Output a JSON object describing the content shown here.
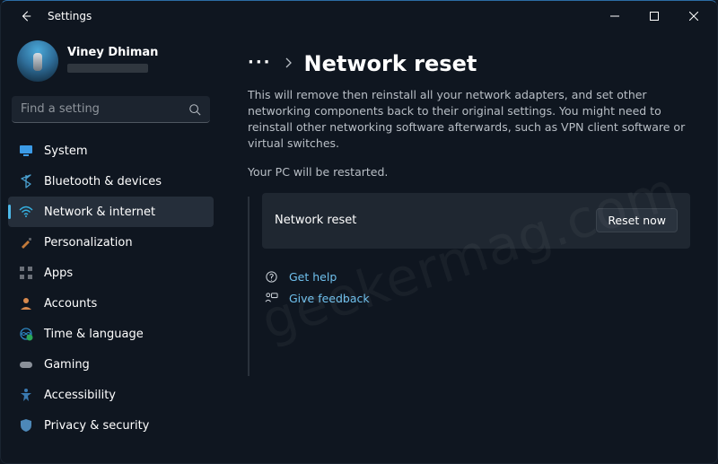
{
  "window": {
    "app_title": "Settings"
  },
  "profile": {
    "name": "Viney Dhiman"
  },
  "search": {
    "placeholder": "Find a setting"
  },
  "sidebar": {
    "items": [
      {
        "id": "system",
        "label": "System",
        "icon": "monitor",
        "color": "#3c9be6"
      },
      {
        "id": "bluetooth",
        "label": "Bluetooth & devices",
        "icon": "bluetooth",
        "color": "#4aa0d0"
      },
      {
        "id": "network",
        "label": "Network & internet",
        "icon": "wifi",
        "color": "#35b0e0",
        "selected": true
      },
      {
        "id": "personalization",
        "label": "Personalization",
        "icon": "brush",
        "color": "#c37a3a"
      },
      {
        "id": "apps",
        "label": "Apps",
        "icon": "apps",
        "color": "#6b7078"
      },
      {
        "id": "accounts",
        "label": "Accounts",
        "icon": "person",
        "color": "#d98a4e"
      },
      {
        "id": "time",
        "label": "Time & language",
        "icon": "globe-clock",
        "color": "#2e86c1"
      },
      {
        "id": "gaming",
        "label": "Gaming",
        "icon": "gamepad",
        "color": "#8a9099"
      },
      {
        "id": "accessibility",
        "label": "Accessibility",
        "icon": "accessibility",
        "color": "#3a7ab1"
      },
      {
        "id": "privacy",
        "label": "Privacy & security",
        "icon": "shield",
        "color": "#4d88b8"
      }
    ]
  },
  "breadcrumb": {
    "more": "···",
    "title": "Network reset"
  },
  "page": {
    "description": "This will remove then reinstall all your network adapters, and set other networking components back to their original settings. You might need to reinstall other networking software afterwards, such as VPN client software or virtual switches.",
    "restart_note": "Your PC will be restarted.",
    "card": {
      "label": "Network reset",
      "button": "Reset now"
    },
    "links": {
      "help": "Get help",
      "feedback": "Give feedback"
    }
  },
  "watermark": "geekermag.com"
}
